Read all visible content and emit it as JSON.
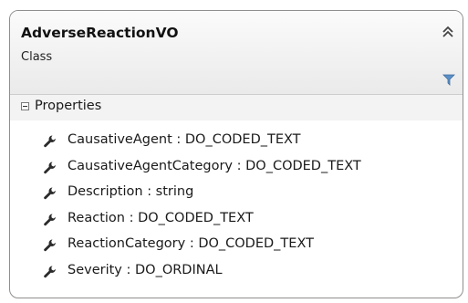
{
  "class_box": {
    "name": "AdverseReactionVO",
    "kind": "Class",
    "section": {
      "title": "Properties",
      "items": [
        {
          "label": "CausativeAgent : DO_CODED_TEXT"
        },
        {
          "label": "CausativeAgentCategory : DO_CODED_TEXT"
        },
        {
          "label": "Description : string"
        },
        {
          "label": "Reaction : DO_CODED_TEXT"
        },
        {
          "label": "ReactionCategory : DO_CODED_TEXT"
        },
        {
          "label": "Severity : DO_ORDINAL"
        }
      ]
    }
  },
  "icons": {
    "collapse": "double-chevron-up-icon",
    "filter": "filter-funnel-icon",
    "expander": "minus-box-icon",
    "property": "wrench-icon"
  },
  "colors": {
    "border": "#8f8f8f",
    "header_top": "#fbfbfb",
    "header_bottom": "#eaeaea",
    "filter": "#5b8fc7"
  }
}
